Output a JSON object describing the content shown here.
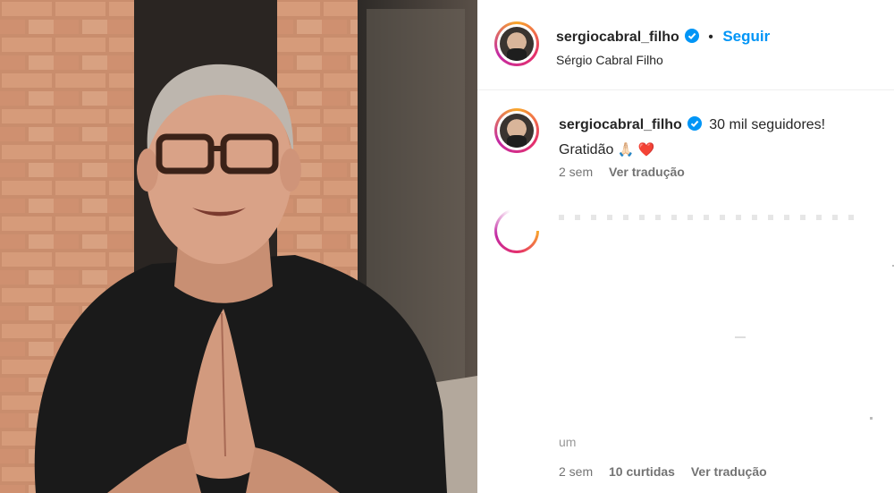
{
  "post_header": {
    "username": "sergiocabral_filho",
    "dot": "•",
    "follow_label": "Seguir",
    "subtitle": "Sérgio Cabral Filho"
  },
  "caption": {
    "username": "sergiocabral_filho",
    "text_line1": "30 mil seguidores!",
    "text_line2": "Gratidão",
    "emoji": "🙏🏻 ❤️",
    "time": "2 sem",
    "translate_label": "Ver tradução"
  },
  "comment": {
    "partial_text": "um",
    "time": "2 sem",
    "likes": "10 curtidas",
    "translate_label": "Ver tradução"
  },
  "colors": {
    "link_blue": "#0095f6",
    "verified_blue": "#0095f6",
    "heart_red": "#e0245e"
  }
}
